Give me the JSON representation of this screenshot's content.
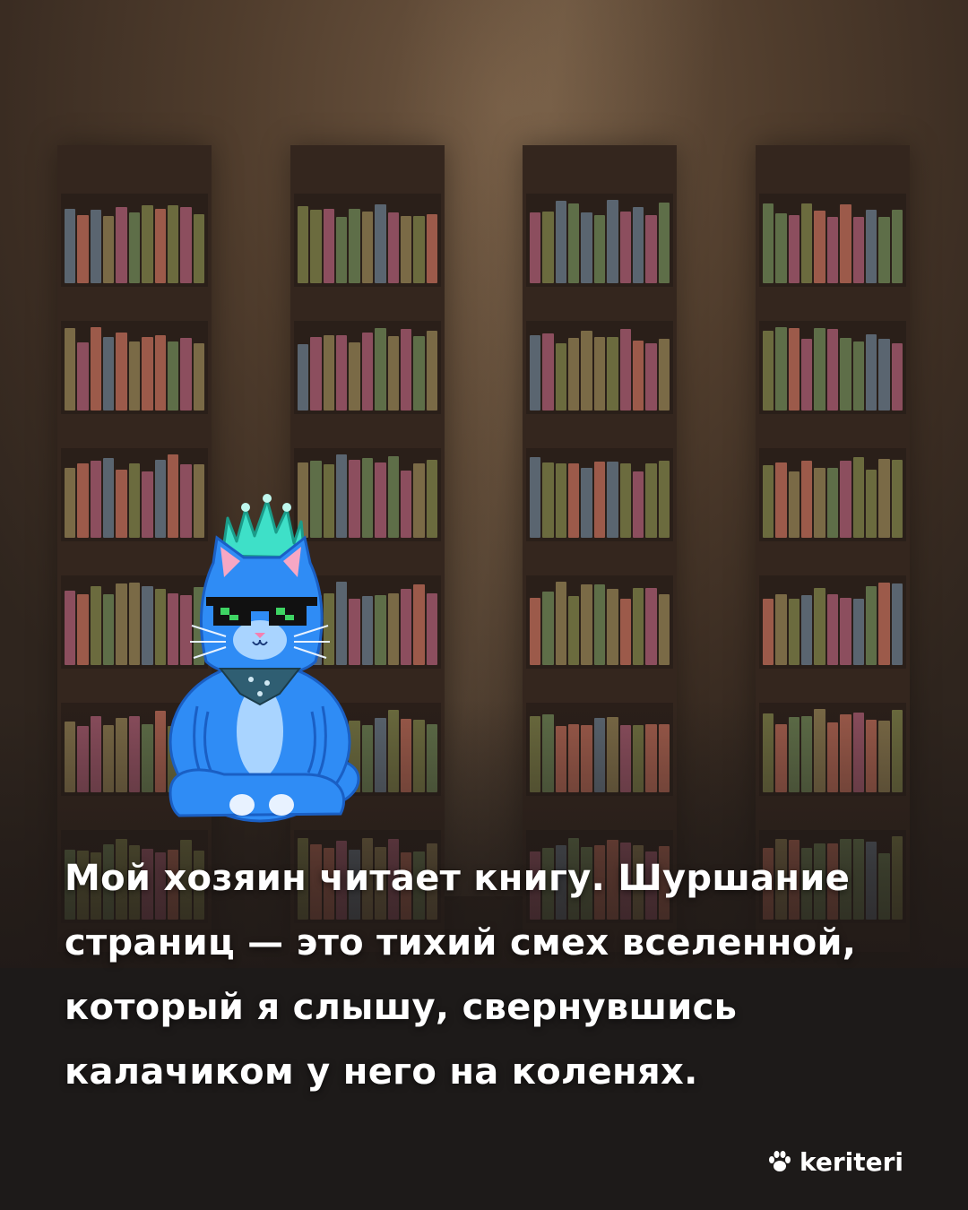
{
  "caption": {
    "line1": "Мой хозяин читает книгу. Шуршание",
    "line2": "страниц — это тихий смех вселенной,",
    "line3": "который я слышу, свернувшись",
    "line4": "калачиком у него на коленях."
  },
  "brand": {
    "name": "keriteri",
    "icon": "paw-icon"
  },
  "colors": {
    "background": "#4f3c2c",
    "bottom_band": "#1d1a19",
    "cat_body": "#2f8cf5",
    "cat_crest": "#3ee0c8",
    "book_palette": [
      "#6b6b3e",
      "#9c5a4a",
      "#8c4e5e",
      "#5a6570",
      "#5e6e48",
      "#7a6a46"
    ]
  }
}
